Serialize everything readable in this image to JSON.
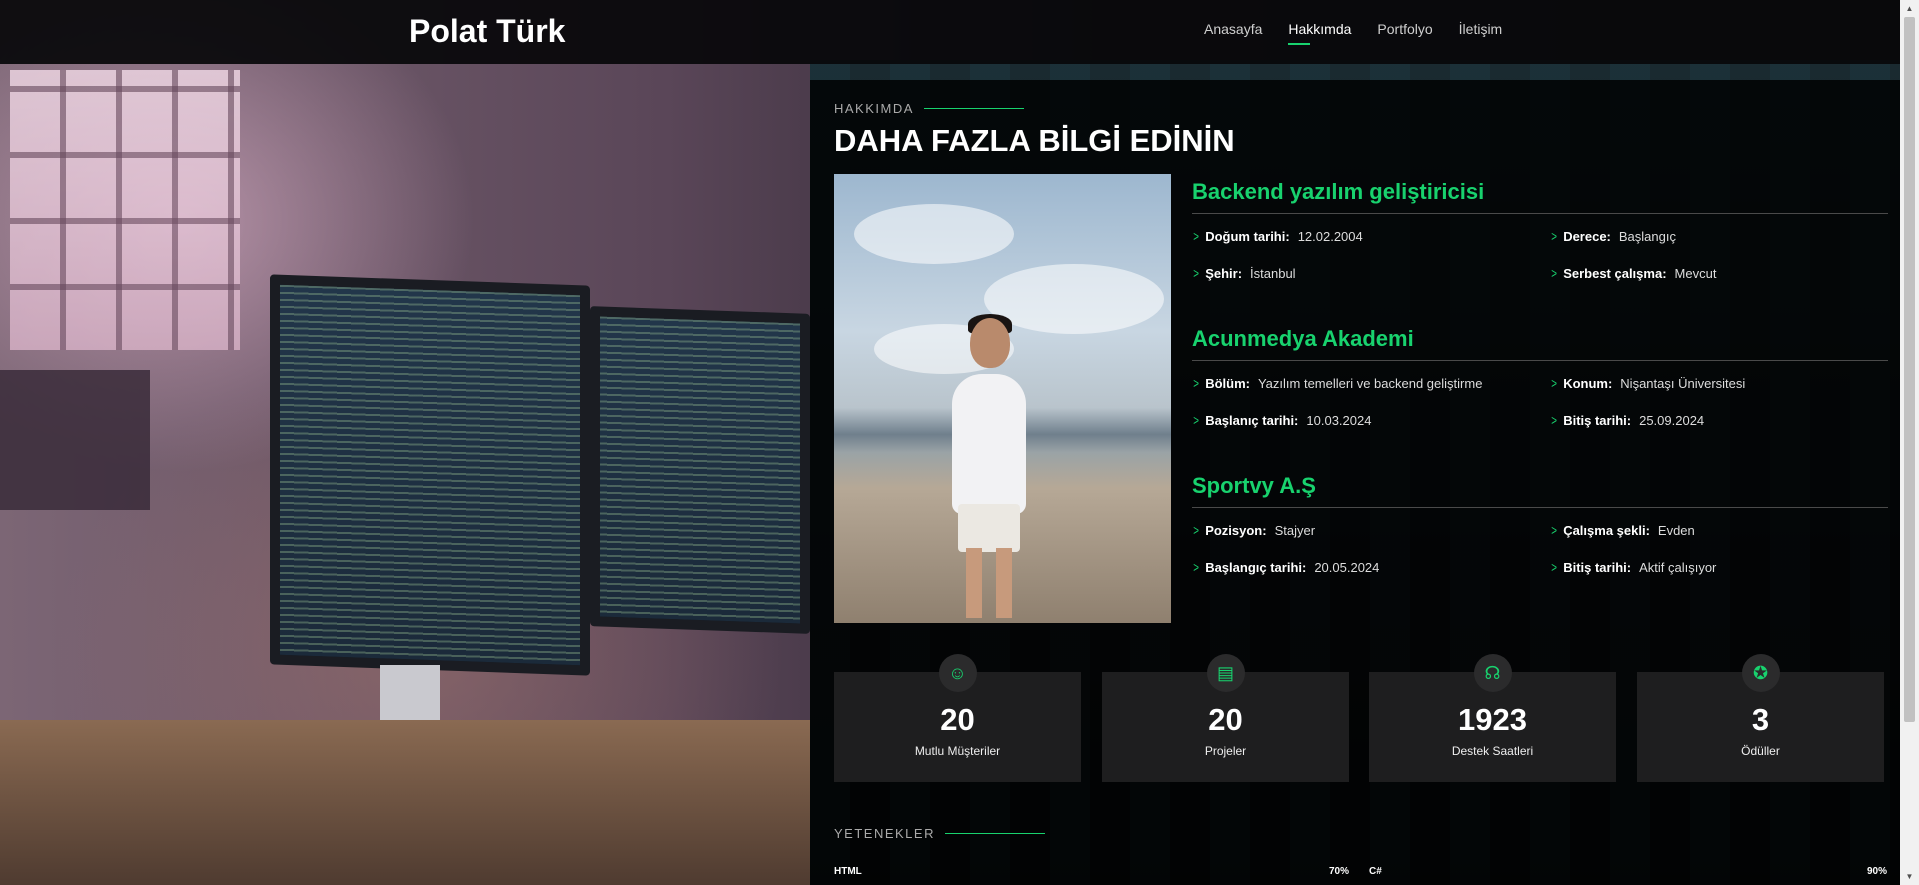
{
  "brand": "Polat Türk",
  "nav": [
    "Anasayfa",
    "Hakkımda",
    "Portfolyo",
    "İletişim"
  ],
  "about": {
    "label": "HAKKIMDA",
    "title": "DAHA FAZLA BİLGİ EDİNİN",
    "groups": [
      {
        "heading": "Backend yazılım geliştiricisi",
        "items": [
          {
            "key": "Doğum tarihi:",
            "value": "12.02.2004"
          },
          {
            "key": "Derece:",
            "value": "Başlangıç"
          },
          {
            "key": "Şehir:",
            "value": "İstanbul"
          },
          {
            "key": "Serbest çalışma:",
            "value": "Mevcut"
          }
        ]
      },
      {
        "heading": "Acunmedya Akademi",
        "items": [
          {
            "key": "Bölüm:",
            "value": "Yazılım temelleri ve backend geliştirme"
          },
          {
            "key": "Konum:",
            "value": "Nişantaşı Üniversitesi"
          },
          {
            "key": "Başlanıç tarihi:",
            "value": "10.03.2024"
          },
          {
            "key": "Bitiş tarihi:",
            "value": "25.09.2024"
          }
        ]
      },
      {
        "heading": "Sportvy A.Ş",
        "items": [
          {
            "key": "Pozisyon:",
            "value": "Stajyer"
          },
          {
            "key": "Çalışma şekli:",
            "value": "Evden"
          },
          {
            "key": "Başlangıç tarihi:",
            "value": "20.05.2024"
          },
          {
            "key": "Bitiş tarihi:",
            "value": "Aktif çalışıyor"
          }
        ]
      }
    ]
  },
  "stats": [
    {
      "icon": "smiley-icon",
      "glyph": "☺",
      "number": "20",
      "label": "Mutlu Müşteriler"
    },
    {
      "icon": "journal-icon",
      "glyph": "▤",
      "number": "20",
      "label": "Projeler"
    },
    {
      "icon": "headset-icon",
      "glyph": "☊",
      "number": "1923",
      "label": "Destek Saatleri"
    },
    {
      "icon": "award-icon",
      "glyph": "✪",
      "number": "3",
      "label": "Ödüller"
    }
  ],
  "skills": {
    "label": "YETENEKLER",
    "items": [
      {
        "name": "HTML",
        "percent": "70%"
      },
      {
        "name": "C#",
        "percent": "90%"
      }
    ]
  },
  "colors": {
    "accent": "#18d26e",
    "panel": "#000000",
    "nav": "#08080a"
  }
}
